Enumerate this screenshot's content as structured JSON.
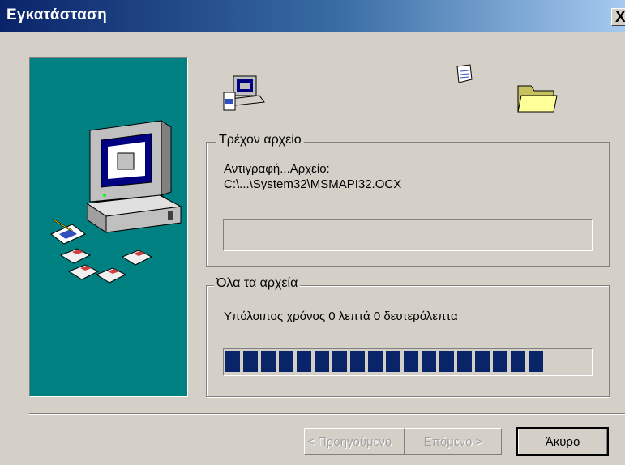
{
  "window": {
    "title": "Εγκατάσταση",
    "close_label": "X"
  },
  "current_file": {
    "legend": "Τρέχον αρχείο",
    "line1": "Αντιγραφή...Αρχείο:",
    "line2": "C:\\...\\System32\\MSMAPI32.OCX",
    "progress": 0
  },
  "all_files": {
    "legend": "Όλα τα αρχεία",
    "remaining_text": "Υπόλοιπος χρόνος 0 λεπτά 0 δευτερόλεπτα",
    "progress": 1.0,
    "block_count": 18
  },
  "buttons": {
    "back_label": "< Προηγούμενο",
    "next_label": "Επόμενο >",
    "cancel_label": "Άκυρο"
  },
  "icons": [
    "computer-icon",
    "floppy-disk-icon",
    "setup-computer-icon",
    "flying-paper-icon",
    "folder-icon"
  ],
  "colors": {
    "accent": "#0a246a",
    "panel": "#008080",
    "face": "#d4d0c8"
  }
}
